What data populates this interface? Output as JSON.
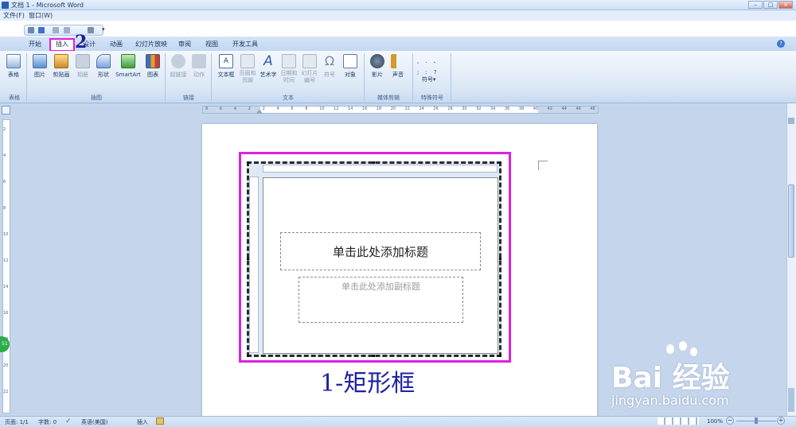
{
  "window": {
    "title": "文档 1 - Microsoft Word",
    "min": "–",
    "max": "□",
    "close": "×"
  },
  "menubar": {
    "items": [
      "文件(F)",
      "窗口(W)"
    ]
  },
  "tabs": [
    "开始",
    "插入",
    "设计",
    "动画",
    "幻灯片放映",
    "审阅",
    "视图",
    "开发工具"
  ],
  "ribbon": {
    "groups": {
      "table": "表格",
      "illustrations": "插图",
      "links": "链接",
      "text": "文本",
      "media": "媒体剪辑",
      "symbols": "特殊符号"
    },
    "buttons": {
      "table": "表格",
      "picture": "图片",
      "clipart": "剪贴画",
      "album": "相册",
      "shapes": "形状",
      "smartart": "SmartArt",
      "chart": "图表",
      "hyperlink": "超链接",
      "action": "动作",
      "textbox": "文本框",
      "header_footer_1": "页眉和",
      "header_footer_2": "页脚",
      "wordart": "艺术字",
      "datetime_1": "日期和",
      "datetime_2": "时间",
      "slidenum_1": "幻灯片",
      "slidenum_2": "编号",
      "symbol": "符号",
      "object": "对象",
      "movie": "影片",
      "sound": "声音",
      "symbols_btn": "符号"
    }
  },
  "ruler_top": [
    "8",
    "6",
    "4",
    "2",
    "2",
    "4",
    "6",
    "8",
    "10",
    "12",
    "14",
    "16",
    "18",
    "20",
    "22",
    "24",
    "26",
    "28",
    "30",
    "32",
    "34",
    "36",
    "38",
    "40",
    "42",
    "44",
    "46",
    "48"
  ],
  "ruler_left": [
    "2",
    "4",
    "6",
    "8",
    "10",
    "12",
    "14",
    "16",
    "18",
    "20",
    "22"
  ],
  "slide": {
    "title_placeholder": "单击此处添加标题",
    "subtitle_placeholder": "单击此处添加副标题"
  },
  "annotations": {
    "caption": "1-矩形框",
    "step": "2"
  },
  "statusbar": {
    "page": "页面: 1/1",
    "words": "字数: 0",
    "lang": "英语(美国)",
    "mode": "插入",
    "zoom": "100%"
  },
  "watermark": {
    "brand": "Bai 经验",
    "url": "jingyan.baidu.com"
  },
  "badge": "51",
  "colors": {
    "highlight": "#df1fe0",
    "caption": "#1f24a0"
  }
}
